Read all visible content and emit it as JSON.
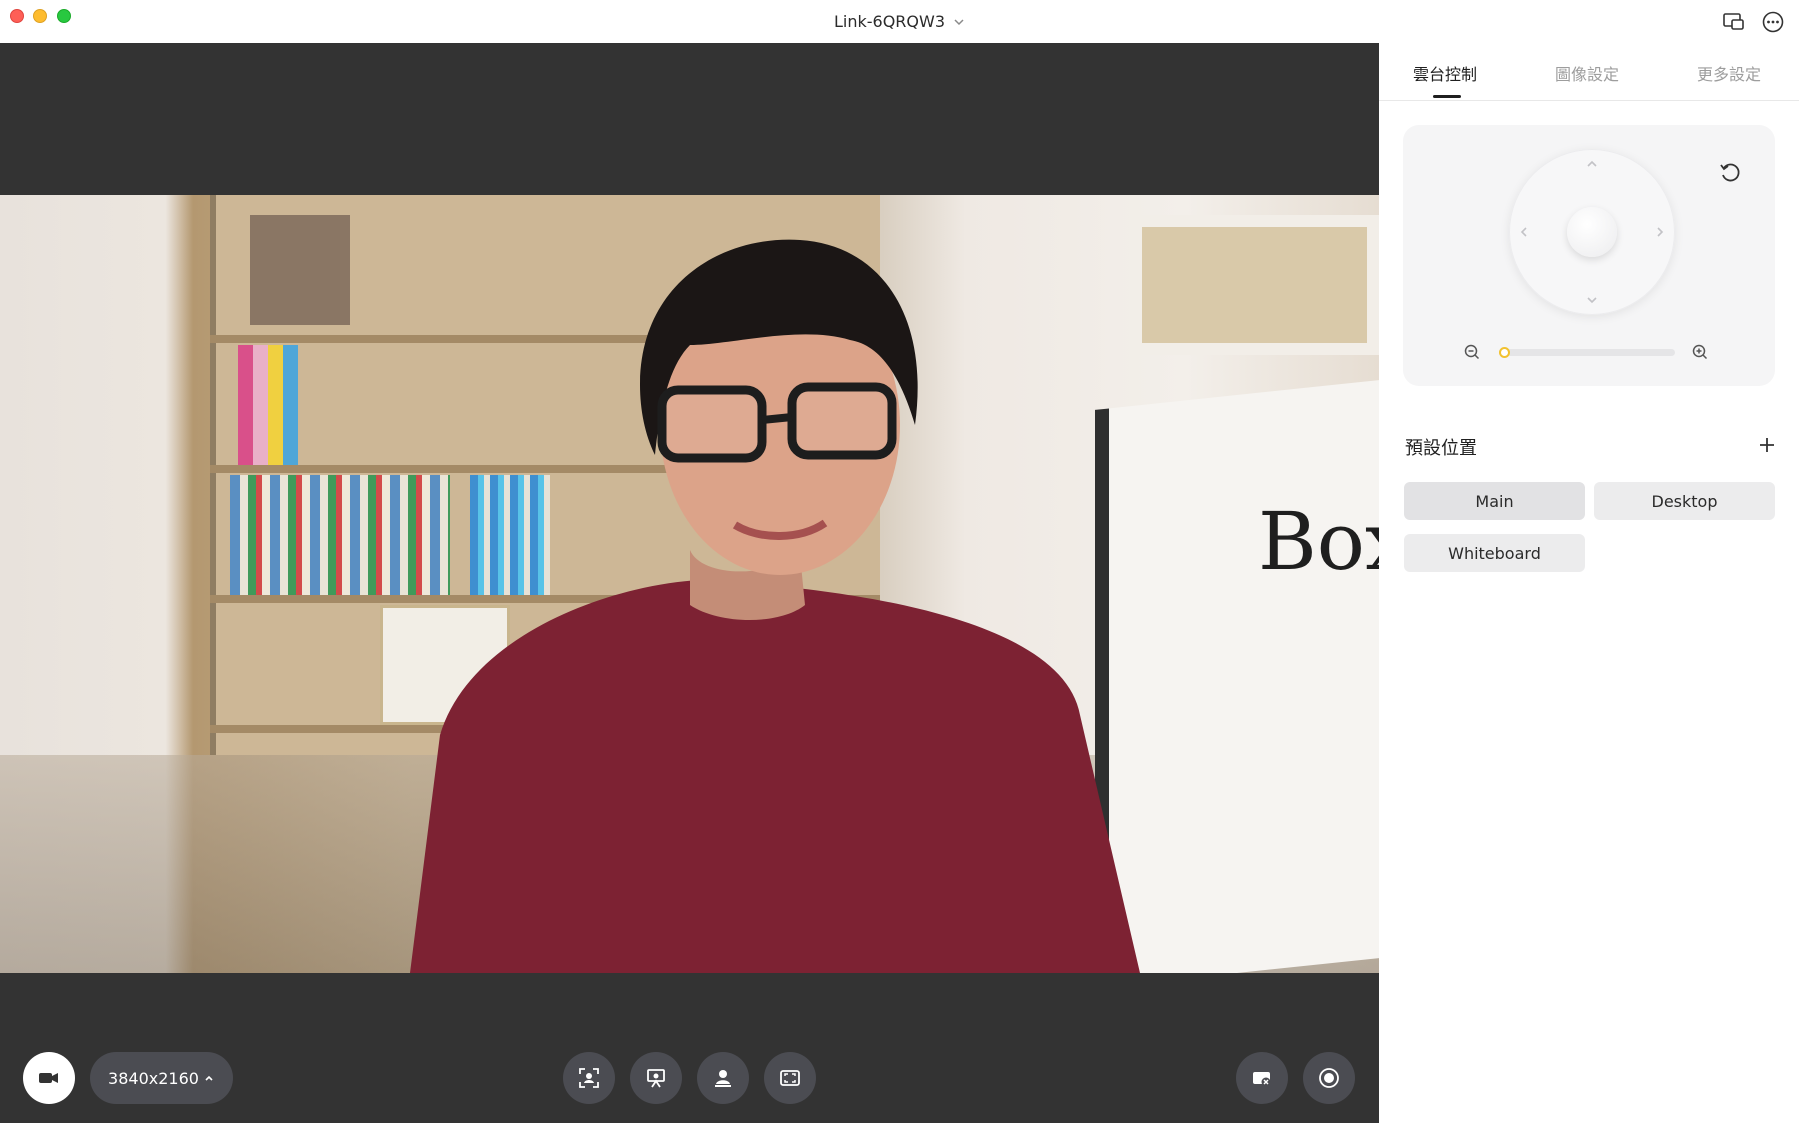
{
  "window": {
    "title": "Link-6QRQW3"
  },
  "video": {
    "resolution": "3840x2160",
    "whiteboard_text": "Box"
  },
  "panel": {
    "tabs": [
      {
        "label": "雲台控制",
        "active": true
      },
      {
        "label": "圖像設定",
        "active": false
      },
      {
        "label": "更多設定",
        "active": false
      }
    ],
    "ptz": {
      "zoom_level": 0
    },
    "presets": {
      "title": "預設位置",
      "items": [
        "Main",
        "Desktop",
        "Whiteboard"
      ],
      "selected": "Main"
    }
  },
  "colors": {
    "accent": "#f2c230",
    "video_bg": "#333333",
    "button_bg": "#4b4c52"
  },
  "icons": {
    "controls_center": [
      "auto-framing-icon",
      "presenter-icon",
      "person-tracking-icon",
      "screen-capture-icon"
    ],
    "controls_right": [
      "camera-off-icon",
      "record-icon"
    ]
  }
}
